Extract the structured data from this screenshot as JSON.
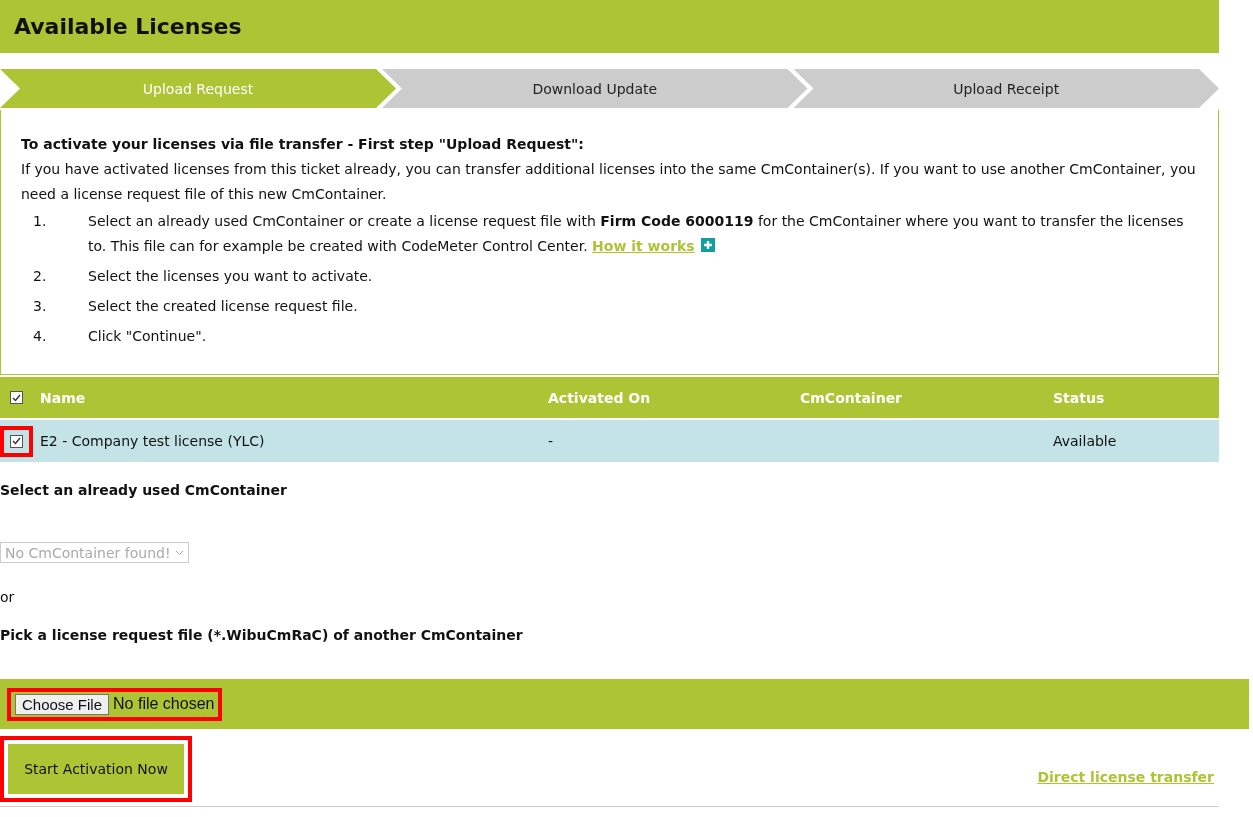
{
  "page_title": "Available Licenses",
  "steps": [
    {
      "label": "Upload Request",
      "selected": true
    },
    {
      "label": "Download Update",
      "selected": false
    },
    {
      "label": "Upload Receipt",
      "selected": false
    }
  ],
  "instructions": {
    "heading": "To activate your licenses via file transfer - First step \"Upload Request\":",
    "intro": "If you have activated licenses from this ticket already, you can transfer additional licenses into the same CmContainer(s). If you want to use another CmContainer, you need a license request file of this new CmContainer.",
    "items": [
      {
        "number": "1.",
        "text": "Select an already used CmContainer or create a license request file with **Firm Code 6000119** for the CmContainer where you want to transfer the licenses to. This file can for example be created with CodeMeter Control Center.",
        "link": "How it works"
      },
      {
        "number": "2.",
        "text": "Select the licenses you want to activate."
      },
      {
        "number": "3.",
        "text": "Select the created license request file."
      },
      {
        "number": "4.",
        "text": "Click \"Continue\"."
      }
    ]
  },
  "table": {
    "select_all_checked": true,
    "columns": [
      "Name",
      "Activated On",
      "CmContainer",
      "Status"
    ],
    "rows": [
      {
        "checked": true,
        "highlighted": true,
        "name": "E2 - Company test license (YLC)",
        "activated_on": "-",
        "status": "Available"
      }
    ]
  },
  "container_select": {
    "label": "Select an already used CmContainer",
    "value": "No CmContainer found!",
    "disabled": true
  },
  "or_text": "or",
  "file_pick": {
    "label": "Pick a license request file (*.WibuCmRaC) of another CmContainer",
    "button": "Choose File",
    "status": "No file chosen",
    "highlighted": true
  },
  "start_button": {
    "label": "Start Activation Now",
    "highlighted": true
  },
  "direct_link": "Direct license transfer"
}
